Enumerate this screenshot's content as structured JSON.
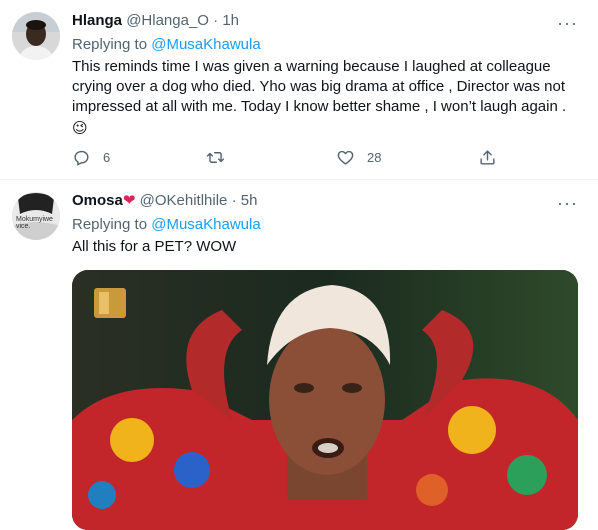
{
  "tweets": [
    {
      "name": "Hlanga",
      "handle": "@Hlanga_O",
      "time": "1h",
      "replying_prefix": "Replying to",
      "replying_to": "@MusaKhawula",
      "text": "This reminds time I was given a warning because I laughed at colleague crying over a dog who died. Yho was big drama at office , Director was not impressed at all with me.  Today I know better shame , I won’t laugh again .",
      "emoji": "😉",
      "actions": {
        "reply_count": "6",
        "retweet_count": "",
        "like_count": "28"
      },
      "icons": [
        "reply-icon",
        "retweet-icon",
        "like-icon",
        "share-icon",
        "more-icon"
      ]
    },
    {
      "name": "Omosa",
      "name_emoji": "❤",
      "handle": "@OKehitlhile",
      "time": "5h",
      "replying_prefix": "Replying to",
      "replying_to": "@MusaKhawula",
      "text": "All this for a PET? WOW",
      "avatar_text": "Mokumyiwe\nvice."
    }
  ],
  "separator_dot": "·",
  "more_glyph": "···",
  "colors": {
    "accent": "#1d9bf0",
    "secondary_text": "#536471",
    "heart": "#e0245e"
  }
}
